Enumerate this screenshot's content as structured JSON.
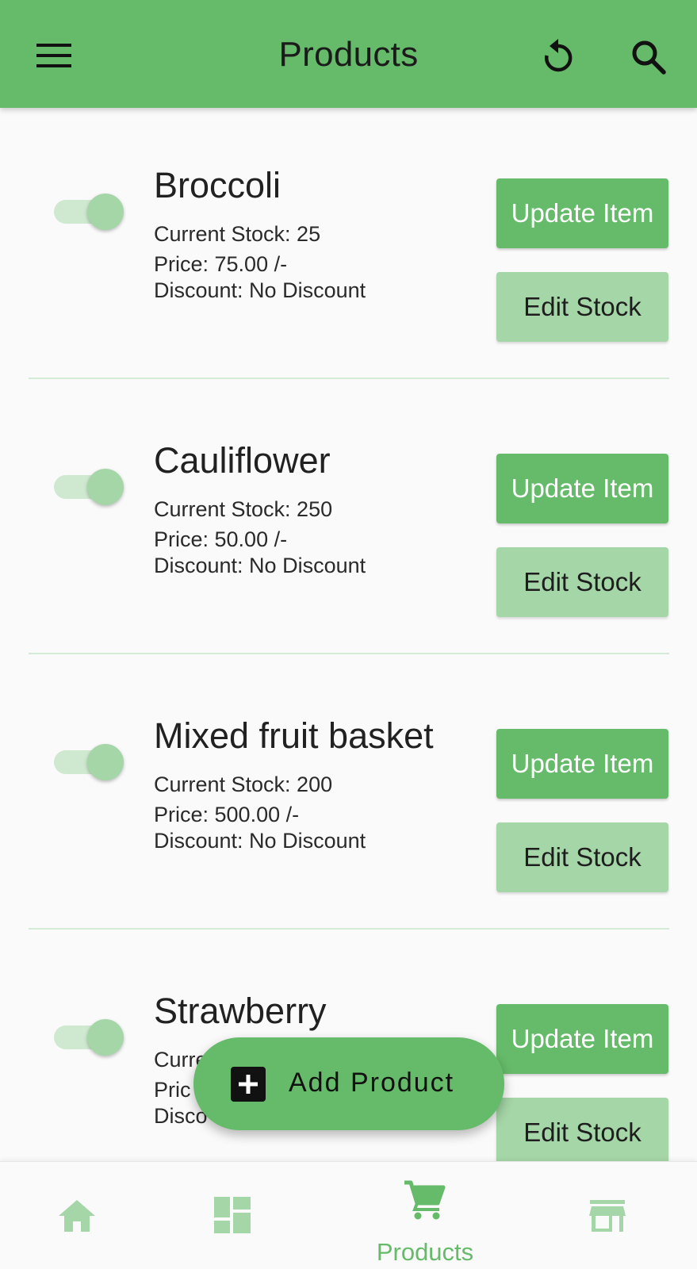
{
  "app_bar": {
    "title": "Products",
    "menu_icon": "menu-icon",
    "refresh_icon": "refresh-icon",
    "search_icon": "search-icon",
    "color": "#66bb6a"
  },
  "products": [
    {
      "name": "Broccoli",
      "stock": "Current Stock: 25",
      "price": "Price: 75.00 /-",
      "discount": "Discount: No Discount",
      "enabled": true,
      "update_label": "Update Item",
      "edit_label": "Edit Stock"
    },
    {
      "name": "Cauliflower",
      "stock": "Current Stock: 250",
      "price": "Price: 50.00 /-",
      "discount": "Discount: No Discount",
      "enabled": true,
      "update_label": "Update Item",
      "edit_label": "Edit Stock"
    },
    {
      "name": "Mixed fruit basket",
      "stock": "Current Stock: 200",
      "price": "Price: 500.00 /-",
      "discount": "Discount: No Discount",
      "enabled": true,
      "update_label": "Update Item",
      "edit_label": "Edit Stock"
    },
    {
      "name": "Strawberry",
      "stock": "Curre",
      "price": "Pric",
      "discount": "Disco",
      "enabled": true,
      "update_label": "Update Item",
      "edit_label": "Edit Stock"
    }
  ],
  "fab": {
    "label": "Add Product",
    "icon": "add-box-icon"
  },
  "bottom_nav": {
    "items": [
      {
        "icon": "home-icon",
        "label": ""
      },
      {
        "icon": "dashboard-icon",
        "label": ""
      },
      {
        "icon": "shopping-cart-icon",
        "label": "Products",
        "active": true
      },
      {
        "icon": "store-icon",
        "label": ""
      }
    ],
    "accent": "#66bb6a"
  }
}
